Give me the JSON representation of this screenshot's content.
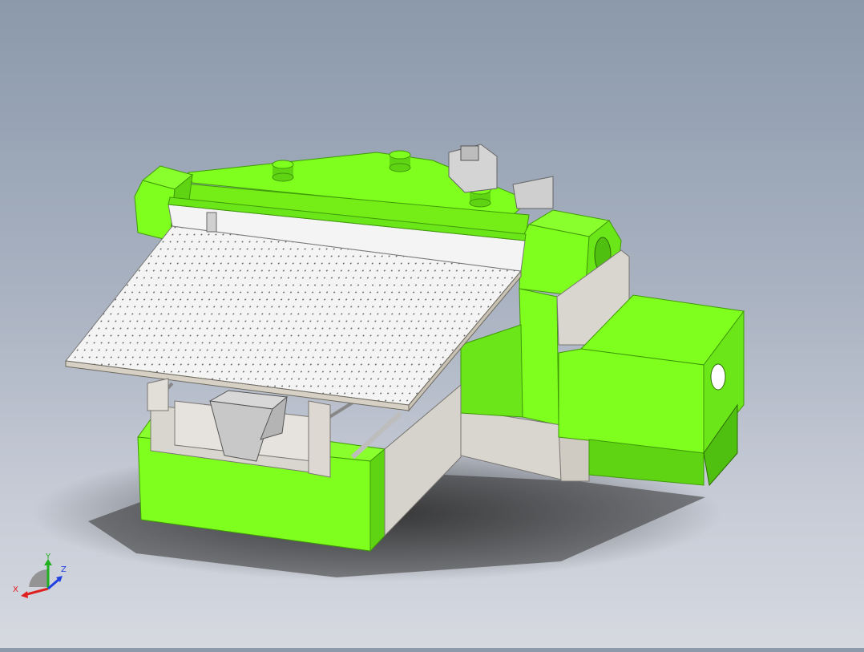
{
  "viewport": {
    "background_top": "#8b99ab",
    "background_bottom": "#d6d9e0",
    "model_colors": {
      "green": "#7fff1e",
      "green_shade": "#5fd412",
      "green_dark": "#3f9a08",
      "table_top": "#f2f2f2",
      "frame": "#d9d6d0",
      "frame_shade": "#bcb6ad",
      "motor": "#c8c8c8",
      "shadow": "#3a3a3a"
    }
  },
  "triad": {
    "x_label": "X",
    "y_label": "Y",
    "z_label": "Z",
    "x_color": "#e02020",
    "y_color": "#20b020",
    "z_color": "#2040e0"
  }
}
